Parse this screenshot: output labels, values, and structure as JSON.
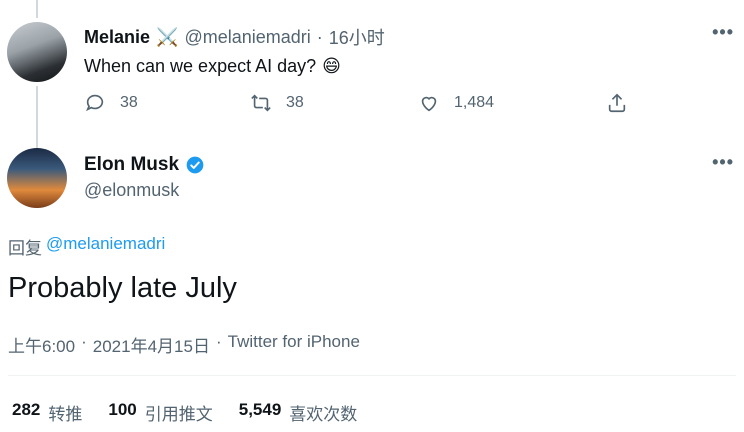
{
  "reply_tweet": {
    "name": "Melanie",
    "handle": "@melaniemadri",
    "separator": "·",
    "time": "16小时",
    "text": "When can we expect AI day?",
    "emoji": "😄",
    "badge_emoji": "⚔️",
    "reply_count": "38",
    "retweet_count": "38",
    "like_count": "1,484"
  },
  "main_tweet": {
    "name": "Elon Musk",
    "handle": "@elonmusk",
    "reply_prefix": "回复",
    "reply_to": "@melaniemadri",
    "text": "Probably late July",
    "time": "上午6:00",
    "separator": "·",
    "date": "2021年4月15日",
    "separator2": "·",
    "source": "Twitter for iPhone"
  },
  "stats": [
    {
      "value": "282",
      "label": "转推"
    },
    {
      "value": "100",
      "label": "引用推文"
    },
    {
      "value": "5,549",
      "label": "喜欢次数"
    }
  ],
  "more_glyph": "•••",
  "colors": {
    "accent": "#1d9bf0",
    "muted": "#536471",
    "text": "#0f1419"
  }
}
